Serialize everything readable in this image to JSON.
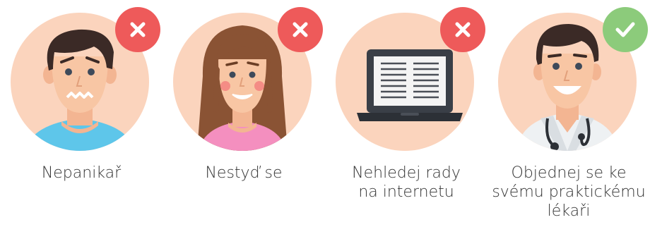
{
  "items": [
    {
      "caption_lines": [
        "Nepanikař"
      ],
      "status": "not-recommended",
      "badge_icon": "close-icon",
      "illustration": "worried-man-icon"
    },
    {
      "caption_lines": [
        "Nestyď se"
      ],
      "status": "not-recommended",
      "badge_icon": "close-icon",
      "illustration": "blushing-woman-icon"
    },
    {
      "caption_lines": [
        "Nehledej rady",
        "na internetu"
      ],
      "status": "not-recommended",
      "badge_icon": "close-icon",
      "illustration": "laptop-icon"
    },
    {
      "caption_lines": [
        "Objednej se ke",
        "svému praktickému",
        "lékaři"
      ],
      "status": "recommended",
      "badge_icon": "check-icon",
      "illustration": "doctor-icon"
    }
  ],
  "colors": {
    "circle_bg": "#fbd4bd",
    "no_badge": "#ee5a5a",
    "yes_badge": "#8ccb7b",
    "caption_text": "#333333"
  }
}
